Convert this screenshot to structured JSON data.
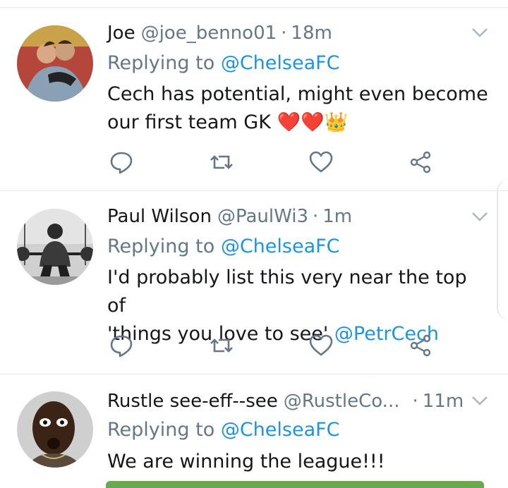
{
  "tweets": [
    {
      "name": "Joe",
      "handle": "@joe_benno01",
      "dot": "·",
      "time": "18m",
      "replying_prefix": "Replying to ",
      "replying_handle": "@ChelseaFC",
      "text_line1": "Cech has potential, might even become",
      "text_line2": "our first team GK ❤️❤️👑"
    },
    {
      "name": "Paul Wilson",
      "handle": "@PaulWi3",
      "dot": "·",
      "time": "1m",
      "replying_prefix": "Replying to ",
      "replying_handle": "@ChelseaFC",
      "text_line1": "I'd probably list this very near the top of",
      "text_line2_prefix": "'things you love to see' ",
      "text_line2_mention": "@PetrCech"
    },
    {
      "name": "Rustle see-eff--see",
      "handle": "@RustleCo...",
      "dot": "·",
      "time": "11m",
      "replying_prefix": "Replying to ",
      "replying_handle": "@ChelseaFC",
      "text_line1": "We are winning the league!!!"
    }
  ],
  "icons": {
    "reply": "reply-icon",
    "retweet": "retweet-icon",
    "like": "heart-icon",
    "share": "share-icon",
    "more": "chevron-down-icon"
  },
  "colors": {
    "text": "#14171a",
    "secondary": "#657786",
    "link": "#1b95e0",
    "divider": "#e1e8ed"
  }
}
